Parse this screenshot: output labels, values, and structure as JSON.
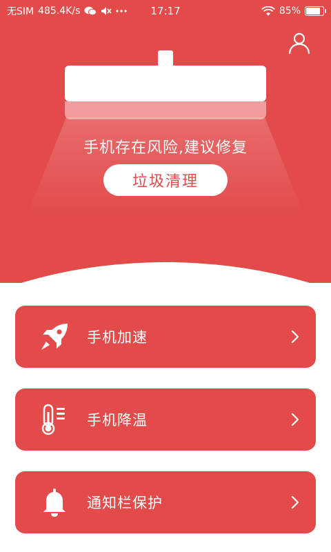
{
  "status_bar": {
    "carrier": "无SIM",
    "speed": "485.4K/s",
    "time": "17:17",
    "battery_percent": "85%",
    "battery_level": 0.85
  },
  "hero": {
    "message": "手机存在风险,建议修复",
    "clean_button_label": "垃圾清理"
  },
  "features": [
    {
      "label": "手机加速",
      "icon": "rocket-icon"
    },
    {
      "label": "手机降温",
      "icon": "thermometer-icon"
    },
    {
      "label": "通知栏保护",
      "icon": "bell-icon"
    }
  ],
  "colors": {
    "primary": "#e34b4b",
    "background": "#ffffff"
  }
}
